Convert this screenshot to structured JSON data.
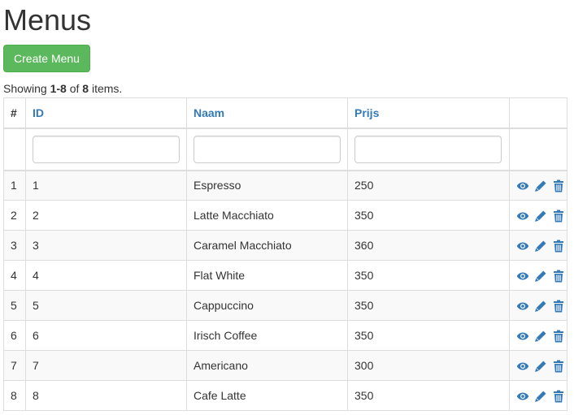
{
  "page": {
    "title": "Menus",
    "create_button": "Create Menu"
  },
  "summary": {
    "prefix": "Showing ",
    "range": "1-8",
    "of": " of ",
    "total": "8",
    "suffix": " items."
  },
  "table": {
    "columns": {
      "num": "#",
      "id": "ID",
      "naam": "Naam",
      "prijs": "Prijs"
    },
    "filters": {
      "id": "",
      "naam": "",
      "prijs": ""
    },
    "rows": [
      {
        "num": "1",
        "id": "1",
        "naam": "Espresso",
        "prijs": "250"
      },
      {
        "num": "2",
        "id": "2",
        "naam": "Latte Macchiato",
        "prijs": "350"
      },
      {
        "num": "3",
        "id": "3",
        "naam": "Caramel Macchiato",
        "prijs": "360"
      },
      {
        "num": "4",
        "id": "4",
        "naam": "Flat White",
        "prijs": "350"
      },
      {
        "num": "5",
        "id": "5",
        "naam": "Cappuccino",
        "prijs": "350"
      },
      {
        "num": "6",
        "id": "6",
        "naam": "Irisch Coffee",
        "prijs": "350"
      },
      {
        "num": "7",
        "id": "7",
        "naam": "Americano",
        "prijs": "300"
      },
      {
        "num": "8",
        "id": "8",
        "naam": "Cafe Latte",
        "prijs": "350"
      }
    ],
    "row_actions": [
      "eye-icon",
      "pencil-icon",
      "trash-icon"
    ]
  },
  "colors": {
    "link": "#337ab7",
    "success": "#5cb85c",
    "border": "#dddddd",
    "stripe": "#f9f9f9"
  }
}
